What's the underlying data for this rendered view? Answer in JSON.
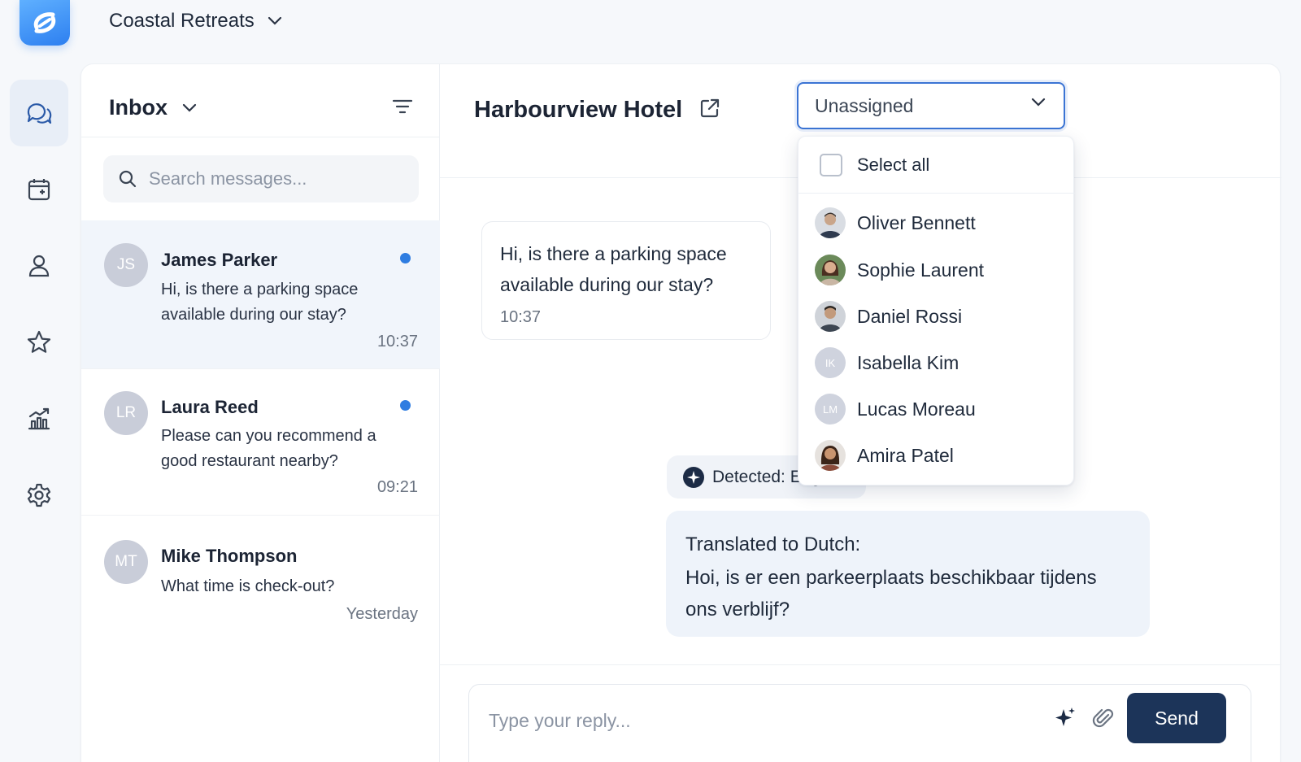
{
  "app": {
    "logo_icon": "brand-logo-icon",
    "workspace_name": "Coastal Retreats"
  },
  "rail": {
    "items": [
      {
        "icon": "chat-icon",
        "active": true
      },
      {
        "icon": "calendar-icon",
        "active": false
      },
      {
        "icon": "user-icon",
        "active": false
      },
      {
        "icon": "star-icon",
        "active": false
      },
      {
        "icon": "analytics-icon",
        "active": false
      },
      {
        "icon": "settings-icon",
        "active": false
      }
    ]
  },
  "inbox": {
    "title": "Inbox",
    "search_placeholder": "Search messages...",
    "conversations": [
      {
        "initials": "JS",
        "name": "James Parker",
        "preview": "Hi, is there a parking space available during our stay?",
        "time": "10:37",
        "unread": true,
        "selected": true
      },
      {
        "initials": "LR",
        "name": "Laura Reed",
        "preview": "Please can you recommend a good restaurant nearby?",
        "time": "09:21",
        "unread": true,
        "selected": false
      },
      {
        "initials": "MT",
        "name": "Mike Thompson",
        "preview": "What time is check-out?",
        "time": "Yesterday",
        "unread": false,
        "selected": false
      }
    ]
  },
  "chat": {
    "title": "Harbourview Hotel",
    "assignee": {
      "selected": "Unassigned",
      "select_all_label": "Select all",
      "options": [
        {
          "name": "Oliver Bennett",
          "avatar": "photo"
        },
        {
          "name": "Sophie Laurent",
          "avatar": "photo"
        },
        {
          "name": "Daniel Rossi",
          "avatar": "photo"
        },
        {
          "name": "Isabella Kim",
          "avatar": "initials",
          "initials": "IK"
        },
        {
          "name": "Lucas Moreau",
          "avatar": "initials",
          "initials": "LM"
        },
        {
          "name": "Amira Patel",
          "avatar": "photo"
        }
      ]
    },
    "message": {
      "text": "Hi, is there a parking space available during our stay?",
      "time": "10:37"
    },
    "detected_language": "Detected: English",
    "translation": {
      "heading": "Translated to Dutch:",
      "text": "Hoi, is er een parkeerplaats beschikbaar tijdens ons verblijf?"
    },
    "composer": {
      "placeholder": "Type your reply...",
      "send_label": "Send"
    }
  },
  "colors": {
    "accent": "#2f7de1",
    "send_button": "#1c3459",
    "select_border": "#3b74d4"
  }
}
